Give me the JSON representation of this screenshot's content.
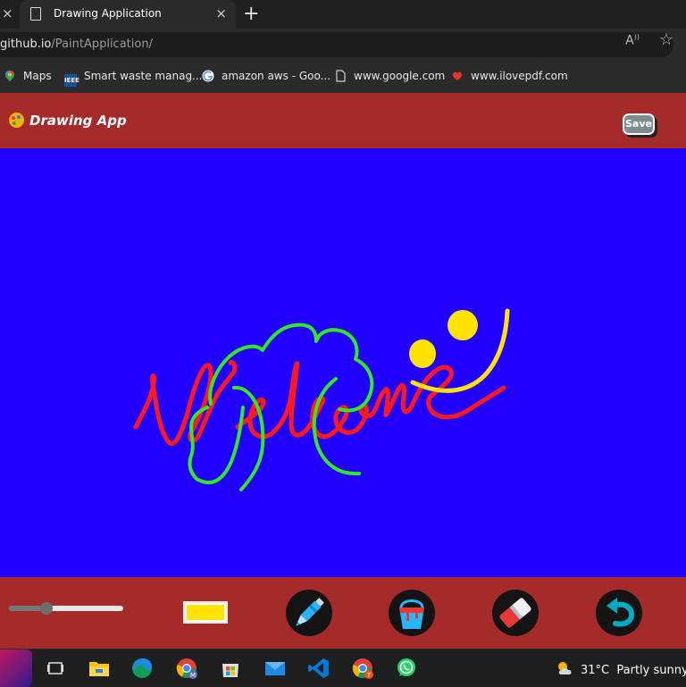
{
  "browser": {
    "tab_title": "Drawing Application",
    "tab_close": "×",
    "left_close": "×",
    "new_tab": "+",
    "url_host": "github.io",
    "url_path": "/PaintApplication/",
    "read_aloud": "Á̩",
    "favorite": "☆",
    "bookmarks": [
      {
        "label": "Maps",
        "icon": "maps-pin-icon"
      },
      {
        "label": "Smart waste manag...",
        "icon": "ieee-icon"
      },
      {
        "label": "amazon aws - Goo...",
        "icon": "google-icon"
      },
      {
        "label": "www.google.com",
        "icon": "document-icon"
      },
      {
        "label": "www.ilovepdf.com",
        "icon": "heart-icon"
      }
    ]
  },
  "app": {
    "title": "Drawing App",
    "save_label": "Save",
    "header_color": "#a52a2a",
    "canvas_color": "#2200ff",
    "brush_size": 0.33,
    "selected_color": "#ffe400",
    "tools": [
      "brush-tool",
      "fill-bucket-tool",
      "eraser-tool",
      "undo-tool"
    ],
    "drawing": {
      "strokes": [
        {
          "color": "#ff1a1a",
          "meaning": "handwritten word"
        },
        {
          "color": "#33e81e",
          "meaning": "tree shape"
        },
        {
          "color": "#ffe400",
          "meaning": "smiley face"
        }
      ],
      "text": "Welcome"
    }
  },
  "taskbar": {
    "apps": [
      "start",
      "task-view",
      "file-explorer",
      "edge",
      "chrome-m",
      "microsoft-store",
      "mail",
      "vscode",
      "chrome-t",
      "whatsapp"
    ],
    "weather_temp": "31°C",
    "weather_desc": "Partly sunny"
  }
}
